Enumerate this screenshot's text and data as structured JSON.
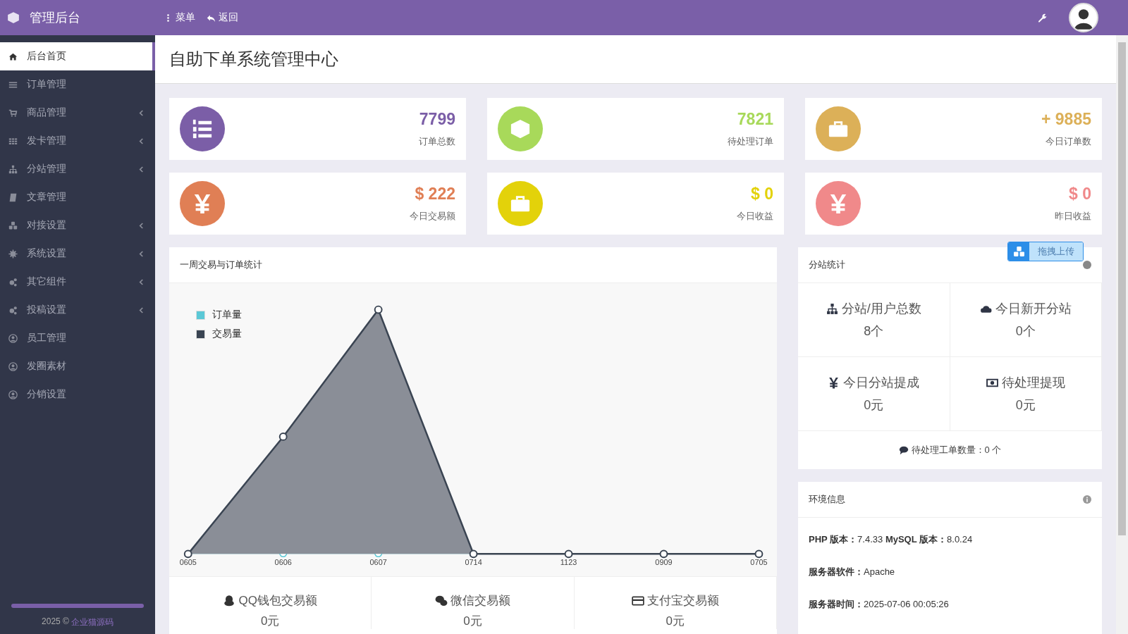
{
  "topbar": {
    "brand": "管理后台",
    "actions": [
      {
        "label": "菜单"
      },
      {
        "label": "返回"
      }
    ]
  },
  "sidebar": {
    "items": [
      {
        "label": "后台首页",
        "selected": true,
        "expandable": false
      },
      {
        "label": "订单管理",
        "selected": false,
        "expandable": false
      },
      {
        "label": "商品管理",
        "selected": false,
        "expandable": true
      },
      {
        "label": "发卡管理",
        "selected": false,
        "expandable": true
      },
      {
        "label": "分站管理",
        "selected": false,
        "expandable": true
      },
      {
        "label": "文章管理",
        "selected": false,
        "expandable": false
      },
      {
        "label": "对接设置",
        "selected": false,
        "expandable": true
      },
      {
        "label": "系统设置",
        "selected": false,
        "expandable": true
      },
      {
        "label": "其它组件",
        "selected": false,
        "expandable": true
      },
      {
        "label": "投稿设置",
        "selected": false,
        "expandable": true
      },
      {
        "label": "员工管理",
        "selected": false,
        "expandable": false
      },
      {
        "label": "发圈素材",
        "selected": false,
        "expandable": false
      },
      {
        "label": "分销设置",
        "selected": false,
        "expandable": false
      }
    ],
    "footer": {
      "text": "2025 ©",
      "link": "企业猫源码"
    }
  },
  "page_title": "自助下单系统管理中心",
  "stats": [
    {
      "value": "7799",
      "label": "订单总数",
      "color": "#7b5ea7"
    },
    {
      "value": "7821",
      "label": "待处理订单",
      "color": "#a8d95a"
    },
    {
      "value": "+ 9885",
      "label": "今日订单数",
      "color": "#dcb058"
    },
    {
      "value": "$ 222",
      "label": "今日交易额",
      "color": "#e07f55"
    },
    {
      "value": "$ 0",
      "label": "今日收益",
      "color": "#e3d20a"
    },
    {
      "value": "$ 0",
      "label": "昨日收益",
      "color": "#f0898a"
    }
  ],
  "chart_panel": {
    "title": "一周交易与订单统计",
    "legend": [
      {
        "label": "订单量",
        "color": "#5bc8d6"
      },
      {
        "label": "交易量",
        "color": "#3a4452"
      }
    ],
    "x_labels": [
      "0605",
      "0606",
      "0607",
      "0714",
      "1123",
      "0909",
      "0705"
    ],
    "totals": [
      {
        "label": "QQ钱包交易额",
        "value": "0元"
      },
      {
        "label": "微信交易额",
        "value": "0元"
      },
      {
        "label": "支付宝交易额",
        "value": "0元"
      }
    ]
  },
  "upload_button": {
    "label": "拖拽上传"
  },
  "substation_panel": {
    "title": "分站统计",
    "cells": [
      {
        "label": "分站/用户总数",
        "value": "8个"
      },
      {
        "label": "今日新开分站",
        "value": "0个"
      },
      {
        "label": "今日分站提成",
        "value": "0元"
      },
      {
        "label": "待处理提现",
        "value": "0元"
      }
    ],
    "footer": "待处理工单数量：0 个"
  },
  "env_panel": {
    "title": "环境信息",
    "lines": [
      "**PHP 版本：**7.4.33 **MySQL 版本：**8.0.24",
      "**服务器软件：**Apache",
      "**服务器时间：**2025-07-06 00:05:26"
    ]
  }
}
